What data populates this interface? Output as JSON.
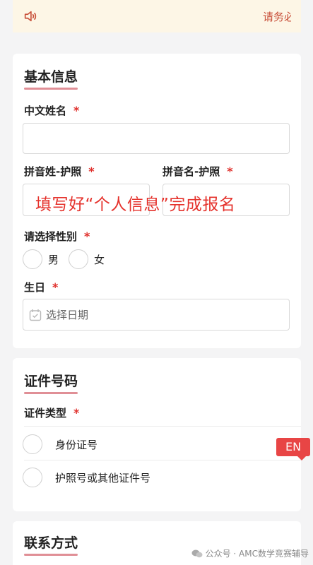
{
  "notice": {
    "text": "请务必",
    "icon": "speaker-icon"
  },
  "basic_info": {
    "title": "基本信息",
    "chinese_name": {
      "label": "中文姓名",
      "required": "*",
      "value": ""
    },
    "pinyin_last": {
      "label": "拼音姓-护照",
      "required": "*",
      "value": ""
    },
    "pinyin_first": {
      "label": "拼音名-护照",
      "required": "*",
      "value": ""
    },
    "gender": {
      "label": "请选择性别",
      "required": "*",
      "options": [
        "男",
        "女"
      ]
    },
    "birthday": {
      "label": "生日",
      "required": "*",
      "placeholder": "选择日期",
      "icon": "calendar-icon"
    }
  },
  "overlay_instruction": "填写好“个人信息”完成报名",
  "id_section": {
    "title": "证件号码",
    "id_type": {
      "label": "证件类型",
      "required": "*",
      "options": [
        "身份证号",
        "护照号或其他证件号"
      ]
    }
  },
  "en_badge": "EN",
  "contact_section": {
    "title": "联系方式"
  },
  "watermark": "公众号 · AMC数学竞赛辅导"
}
